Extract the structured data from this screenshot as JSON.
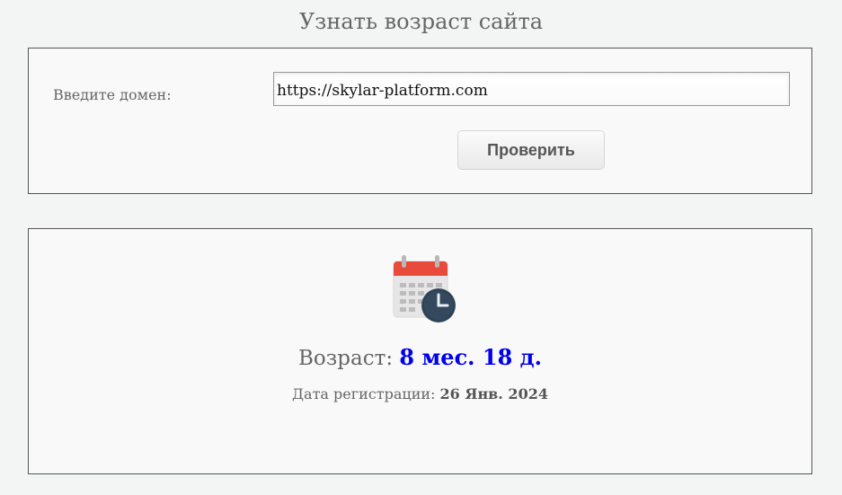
{
  "header": {
    "title": "Узнать возраст сайта"
  },
  "form": {
    "domain_label": "Введите домен:",
    "domain_value": "https://skylar-platform.com",
    "check_button_label": "Проверить"
  },
  "result": {
    "icon": "calendar-clock-icon",
    "age_label": "Возраст:",
    "age_value": "8 мес. 18 д.",
    "registration_label": "Дата регистрации:",
    "registration_value": "26 Янв. 2024",
    "age_color": "#0000ee"
  }
}
